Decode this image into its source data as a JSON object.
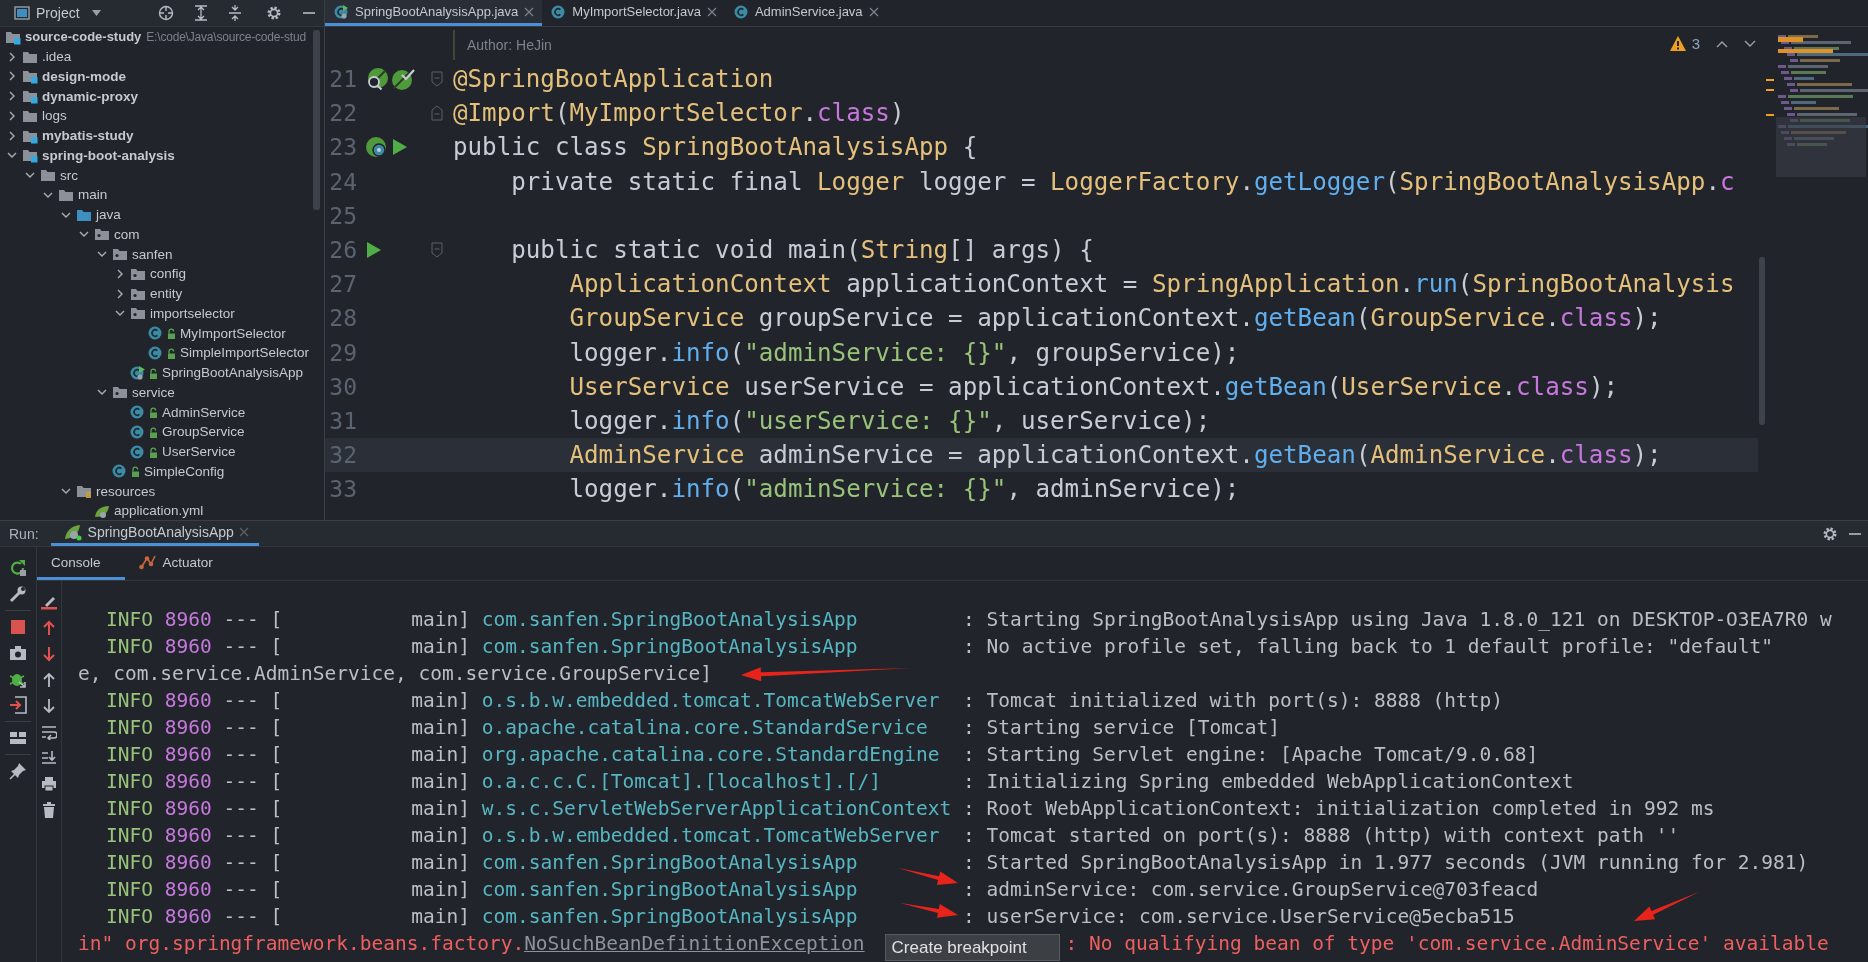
{
  "project_panel": {
    "title": "Project",
    "root": {
      "label": "source-code-study",
      "path": "E:\\code\\Java\\source-code-stud"
    },
    "items": [
      {
        "label": ".idea",
        "kind": "folder",
        "expanded": false
      },
      {
        "label": "design-mode",
        "kind": "module",
        "expanded": false
      },
      {
        "label": "dynamic-proxy",
        "kind": "module",
        "expanded": false
      },
      {
        "label": "logs",
        "kind": "folder",
        "expanded": false
      },
      {
        "label": "mybatis-study",
        "kind": "module",
        "expanded": false
      },
      {
        "label": "spring-boot-analysis",
        "kind": "module",
        "expanded": true,
        "children": [
          {
            "label": "src",
            "kind": "folder",
            "expanded": true,
            "children": [
              {
                "label": "main",
                "kind": "folder",
                "expanded": true,
                "children": [
                  {
                    "label": "java",
                    "kind": "source",
                    "expanded": true,
                    "children": [
                      {
                        "label": "com",
                        "kind": "package",
                        "expanded": true,
                        "children": [
                          {
                            "label": "sanfen",
                            "kind": "package",
                            "expanded": true,
                            "children": [
                              {
                                "label": "config",
                                "kind": "package",
                                "expanded": false
                              },
                              {
                                "label": "entity",
                                "kind": "package",
                                "expanded": false
                              },
                              {
                                "label": "importselector",
                                "kind": "package",
                                "expanded": true,
                                "children": [
                                  {
                                    "label": "MyImportSelector",
                                    "kind": "class"
                                  },
                                  {
                                    "label": "SimpleImportSelector",
                                    "kind": "class"
                                  }
                                ]
                              },
                              {
                                "label": "SpringBootAnalysisApp",
                                "kind": "spring-class"
                              }
                            ]
                          },
                          {
                            "label": "service",
                            "kind": "package",
                            "expanded": true,
                            "children": [
                              {
                                "label": "AdminService",
                                "kind": "class"
                              },
                              {
                                "label": "GroupService",
                                "kind": "class"
                              },
                              {
                                "label": "UserService",
                                "kind": "class"
                              }
                            ]
                          },
                          {
                            "label": "SimpleConfig",
                            "kind": "class"
                          }
                        ]
                      }
                    ]
                  },
                  {
                    "label": "resources",
                    "kind": "resources",
                    "expanded": true,
                    "children": [
                      {
                        "label": "application.yml",
                        "kind": "yaml"
                      }
                    ]
                  }
                ]
              }
            ]
          }
        ]
      }
    ]
  },
  "editor": {
    "tabs": [
      {
        "label": "SpringBootAnalysisApp.java",
        "kind": "spring-class",
        "selected": true
      },
      {
        "label": "MyImportSelector.java",
        "kind": "class",
        "selected": false
      },
      {
        "label": "AdminService.java",
        "kind": "class",
        "selected": false
      }
    ],
    "author": "Author: HeJin",
    "warning_count": "3",
    "lines": [
      {
        "number": "21",
        "current": false,
        "fold": {
          "kind": "start"
        },
        "gutter": [
          {
            "kind": "bean-search"
          },
          {
            "kind": "bean-check"
          }
        ],
        "tokens": [
          {
            "kind": "annotation",
            "text": "@SpringBootApplication"
          }
        ]
      },
      {
        "number": "22",
        "current": false,
        "fold": {
          "kind": "end"
        },
        "tokens": [
          {
            "kind": "annotation",
            "text": "@Import"
          },
          {
            "kind": "plain",
            "text": "("
          },
          {
            "kind": "type",
            "text": "MyImportSelector"
          },
          {
            "kind": "plain",
            "text": "."
          },
          {
            "kind": "keyword",
            "text": "class"
          },
          {
            "kind": "plain",
            "text": ")"
          }
        ]
      },
      {
        "number": "23",
        "current": false,
        "gutter": [
          {
            "kind": "spring-bean"
          },
          {
            "kind": "run"
          }
        ],
        "tokens": [
          {
            "kind": "plain",
            "text": "public class "
          },
          {
            "kind": "type",
            "text": "SpringBootAnalysisApp"
          },
          {
            "kind": "plain",
            "text": " {"
          }
        ]
      },
      {
        "number": "24",
        "current": false,
        "tokens": [
          {
            "kind": "plain",
            "text": "    private static final "
          },
          {
            "kind": "type",
            "text": "Logger"
          },
          {
            "kind": "plain",
            "text": " logger = "
          },
          {
            "kind": "type",
            "text": "LoggerFactory"
          },
          {
            "kind": "plain",
            "text": "."
          },
          {
            "kind": "method",
            "text": "getLogger"
          },
          {
            "kind": "plain",
            "text": "("
          },
          {
            "kind": "type",
            "text": "SpringBootAnalysisApp"
          },
          {
            "kind": "plain",
            "text": "."
          },
          {
            "kind": "keyword",
            "text": "c"
          }
        ]
      },
      {
        "number": "25",
        "current": false
      },
      {
        "number": "26",
        "current": false,
        "fold": {
          "kind": "start"
        },
        "gutter": [
          {
            "kind": "run"
          }
        ],
        "tokens": [
          {
            "kind": "plain",
            "text": "    public static void main("
          },
          {
            "kind": "type",
            "text": "String"
          },
          {
            "kind": "plain",
            "text": "[] args) {"
          }
        ]
      },
      {
        "number": "27",
        "current": false,
        "tokens": [
          {
            "kind": "type",
            "text": "        ApplicationContext"
          },
          {
            "kind": "plain",
            "text": " applicationContext = "
          },
          {
            "kind": "type",
            "text": "SpringApplication"
          },
          {
            "kind": "plain",
            "text": "."
          },
          {
            "kind": "method",
            "text": "run"
          },
          {
            "kind": "plain",
            "text": "("
          },
          {
            "kind": "type",
            "text": "SpringBootAnalysis"
          }
        ]
      },
      {
        "number": "28",
        "current": false,
        "tokens": [
          {
            "kind": "type",
            "text": "        GroupService"
          },
          {
            "kind": "plain",
            "text": " groupService = applicationContext."
          },
          {
            "kind": "method",
            "text": "getBean"
          },
          {
            "kind": "plain",
            "text": "("
          },
          {
            "kind": "type",
            "text": "GroupService"
          },
          {
            "kind": "plain",
            "text": "."
          },
          {
            "kind": "keyword",
            "text": "class"
          },
          {
            "kind": "plain",
            "text": ");"
          }
        ]
      },
      {
        "number": "29",
        "current": false,
        "tokens": [
          {
            "kind": "plain",
            "text": "        logger."
          },
          {
            "kind": "method",
            "text": "info"
          },
          {
            "kind": "plain",
            "text": "("
          },
          {
            "kind": "string",
            "text": "\"adminService: {}\""
          },
          {
            "kind": "plain",
            "text": ", groupService);"
          }
        ]
      },
      {
        "number": "30",
        "current": false,
        "tokens": [
          {
            "kind": "type",
            "text": "        UserService"
          },
          {
            "kind": "plain",
            "text": " userService = applicationContext."
          },
          {
            "kind": "method",
            "text": "getBean"
          },
          {
            "kind": "plain",
            "text": "("
          },
          {
            "kind": "type",
            "text": "UserService"
          },
          {
            "kind": "plain",
            "text": "."
          },
          {
            "kind": "keyword",
            "text": "class"
          },
          {
            "kind": "plain",
            "text": ");"
          }
        ]
      },
      {
        "number": "31",
        "current": false,
        "tokens": [
          {
            "kind": "plain",
            "text": "        logger."
          },
          {
            "kind": "method",
            "text": "info"
          },
          {
            "kind": "plain",
            "text": "("
          },
          {
            "kind": "string",
            "text": "\"userService: {}\""
          },
          {
            "kind": "plain",
            "text": ", userService);"
          }
        ]
      },
      {
        "number": "32",
        "current": true,
        "tokens": [
          {
            "kind": "type",
            "text": "        AdminService"
          },
          {
            "kind": "plain",
            "text": " adminService = applicationContext."
          },
          {
            "kind": "method",
            "text": "getBean"
          },
          {
            "kind": "plain",
            "text": "("
          },
          {
            "kind": "type",
            "text": "AdminService"
          },
          {
            "kind": "plain",
            "text": "."
          },
          {
            "kind": "keyword",
            "text": "class"
          },
          {
            "kind": "plain",
            "text": ");"
          }
        ]
      },
      {
        "number": "33",
        "current": false,
        "tokens": [
          {
            "kind": "plain",
            "text": "        logger."
          },
          {
            "kind": "method",
            "text": "info"
          },
          {
            "kind": "plain",
            "text": "("
          },
          {
            "kind": "string",
            "text": "\"adminService: {}\""
          },
          {
            "kind": "plain",
            "text": ", adminService);"
          }
        ]
      }
    ]
  },
  "run_panel": {
    "label": "Run:",
    "tab": {
      "label": "SpringBootAnalysisApp",
      "selected": true
    },
    "subtabs": [
      {
        "label": "Console",
        "kind": "console",
        "selected": true
      },
      {
        "label": "Actuator",
        "kind": "actuator",
        "selected": false
      }
    ],
    "console": [
      {
        "kind": "log",
        "level": "INFO",
        "pid": "8960",
        "thread": "--- [           main]",
        "logger": "com.sanfen.SpringBootAnalysisApp",
        "message": ": Starting SpringBootAnalysisApp using Java 1.8.0_121 on DESKTOP-O3EA7R0 w"
      },
      {
        "kind": "log",
        "level": "INFO",
        "pid": "8960",
        "thread": "--- [           main]",
        "logger": "com.sanfen.SpringBootAnalysisApp",
        "message": ": No active profile set, falling back to 1 default profile: \"default\""
      },
      {
        "kind": "wrapped",
        "text": "e, com.service.AdminService, com.service.GroupService]"
      },
      {
        "kind": "log",
        "level": "INFO",
        "pid": "8960",
        "thread": "--- [           main]",
        "logger": "o.s.b.w.embedded.tomcat.TomcatWebServer",
        "message": ": Tomcat initialized with port(s): 8888 (http)"
      },
      {
        "kind": "log",
        "level": "INFO",
        "pid": "8960",
        "thread": "--- [           main]",
        "logger": "o.apache.catalina.core.StandardService",
        "message": ": Starting service [Tomcat]"
      },
      {
        "kind": "log",
        "level": "INFO",
        "pid": "8960",
        "thread": "--- [           main]",
        "logger": "org.apache.catalina.core.StandardEngine",
        "message": ": Starting Servlet engine: [Apache Tomcat/9.0.68]"
      },
      {
        "kind": "log",
        "level": "INFO",
        "pid": "8960",
        "thread": "--- [           main]",
        "logger": "o.a.c.c.C.[Tomcat].[localhost].[/]",
        "message": ": Initializing Spring embedded WebApplicationContext"
      },
      {
        "kind": "log",
        "level": "INFO",
        "pid": "8960",
        "thread": "--- [           main]",
        "logger": "w.s.c.ServletWebServerApplicationContext",
        "message": ": Root WebApplicationContext: initialization completed in 992 ms"
      },
      {
        "kind": "log",
        "level": "INFO",
        "pid": "8960",
        "thread": "--- [           main]",
        "logger": "o.s.b.w.embedded.tomcat.TomcatWebServer",
        "message": ": Tomcat started on port(s): 8888 (http) with context path ''"
      },
      {
        "kind": "log",
        "level": "INFO",
        "pid": "8960",
        "thread": "--- [           main]",
        "logger": "com.sanfen.SpringBootAnalysisApp",
        "message": ": Started SpringBootAnalysisApp in 1.977 seconds (JVM running for 2.981)"
      },
      {
        "kind": "log",
        "level": "INFO",
        "pid": "8960",
        "thread": "--- [           main]",
        "logger": "com.sanfen.SpringBootAnalysisApp",
        "message": ": adminService: com.service.GroupService@703feacd"
      },
      {
        "kind": "log",
        "level": "INFO",
        "pid": "8960",
        "thread": "--- [           main]",
        "logger": "com.sanfen.SpringBootAnalysisApp",
        "message": ": userService: com.service.UserService@5ecba515"
      },
      {
        "kind": "error",
        "text": "in\" org.springframework.beans.factory.",
        "link": "NoSuchBeanDefinitionException",
        "tooltip": "Create breakpoint",
        "message": ": No qualifying bean of type 'com.service.AdminService' available"
      }
    ],
    "annotations": [
      {
        "kind": "arrow"
      },
      {
        "kind": "arrow"
      },
      {
        "kind": "arrow"
      },
      {
        "kind": "arrow"
      }
    ]
  }
}
